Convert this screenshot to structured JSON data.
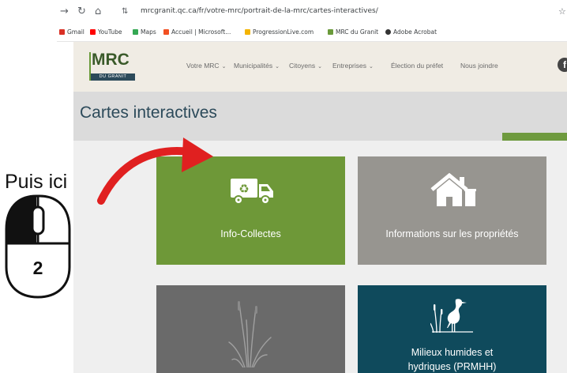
{
  "browser": {
    "url": "mrcgranit.qc.ca/fr/votre-mrc/portrait-de-la-mrc/cartes-interactives/",
    "bookmarks": [
      {
        "label": "Gmail",
        "color": "#d93025"
      },
      {
        "label": "YouTube",
        "color": "#ff0000"
      },
      {
        "label": "Maps",
        "color": "#34a853"
      },
      {
        "label": "Accueil | Microsoft...",
        "color": "#f25022"
      },
      {
        "label": "ProgressionLive.com",
        "color": "#f4b400"
      },
      {
        "label": "MRC du Granit",
        "color": "#6a9a3a"
      },
      {
        "label": "Adobe Acrobat",
        "color": "#333333"
      }
    ]
  },
  "site": {
    "logo_main": "MRC",
    "logo_sub": "DU GRANIT",
    "menu": [
      {
        "label": "Votre MRC",
        "has_dropdown": true
      },
      {
        "label": "Municipalités",
        "has_dropdown": true
      },
      {
        "label": "Citoyens",
        "has_dropdown": true
      },
      {
        "label": "Entreprises",
        "has_dropdown": true
      },
      {
        "label": "Élection du préfet",
        "has_dropdown": false
      },
      {
        "label": "Nous joindre",
        "has_dropdown": false
      }
    ],
    "social_icon": "facebook-icon"
  },
  "page": {
    "title": "Cartes interactives"
  },
  "cards": {
    "collectes": {
      "label": "Info-Collectes",
      "icon": "recycling-truck-icon",
      "color": "#6e9838"
    },
    "proprietes": {
      "label": "Informations sur les propriétés",
      "icon": "house-icon",
      "color": "#979590"
    },
    "milieux": {
      "label": "",
      "icon": "reeds-icon",
      "color": "#6a6a6a"
    },
    "hydro": {
      "label_line1": "Milieux humides et",
      "label_line2": "hydriques (PRMHH)",
      "icon": "heron-icon",
      "color": "#0f4a5c"
    }
  },
  "overlay": {
    "instruction": "Puis ici",
    "step_number": "2",
    "arrow_color": "#e02020"
  }
}
